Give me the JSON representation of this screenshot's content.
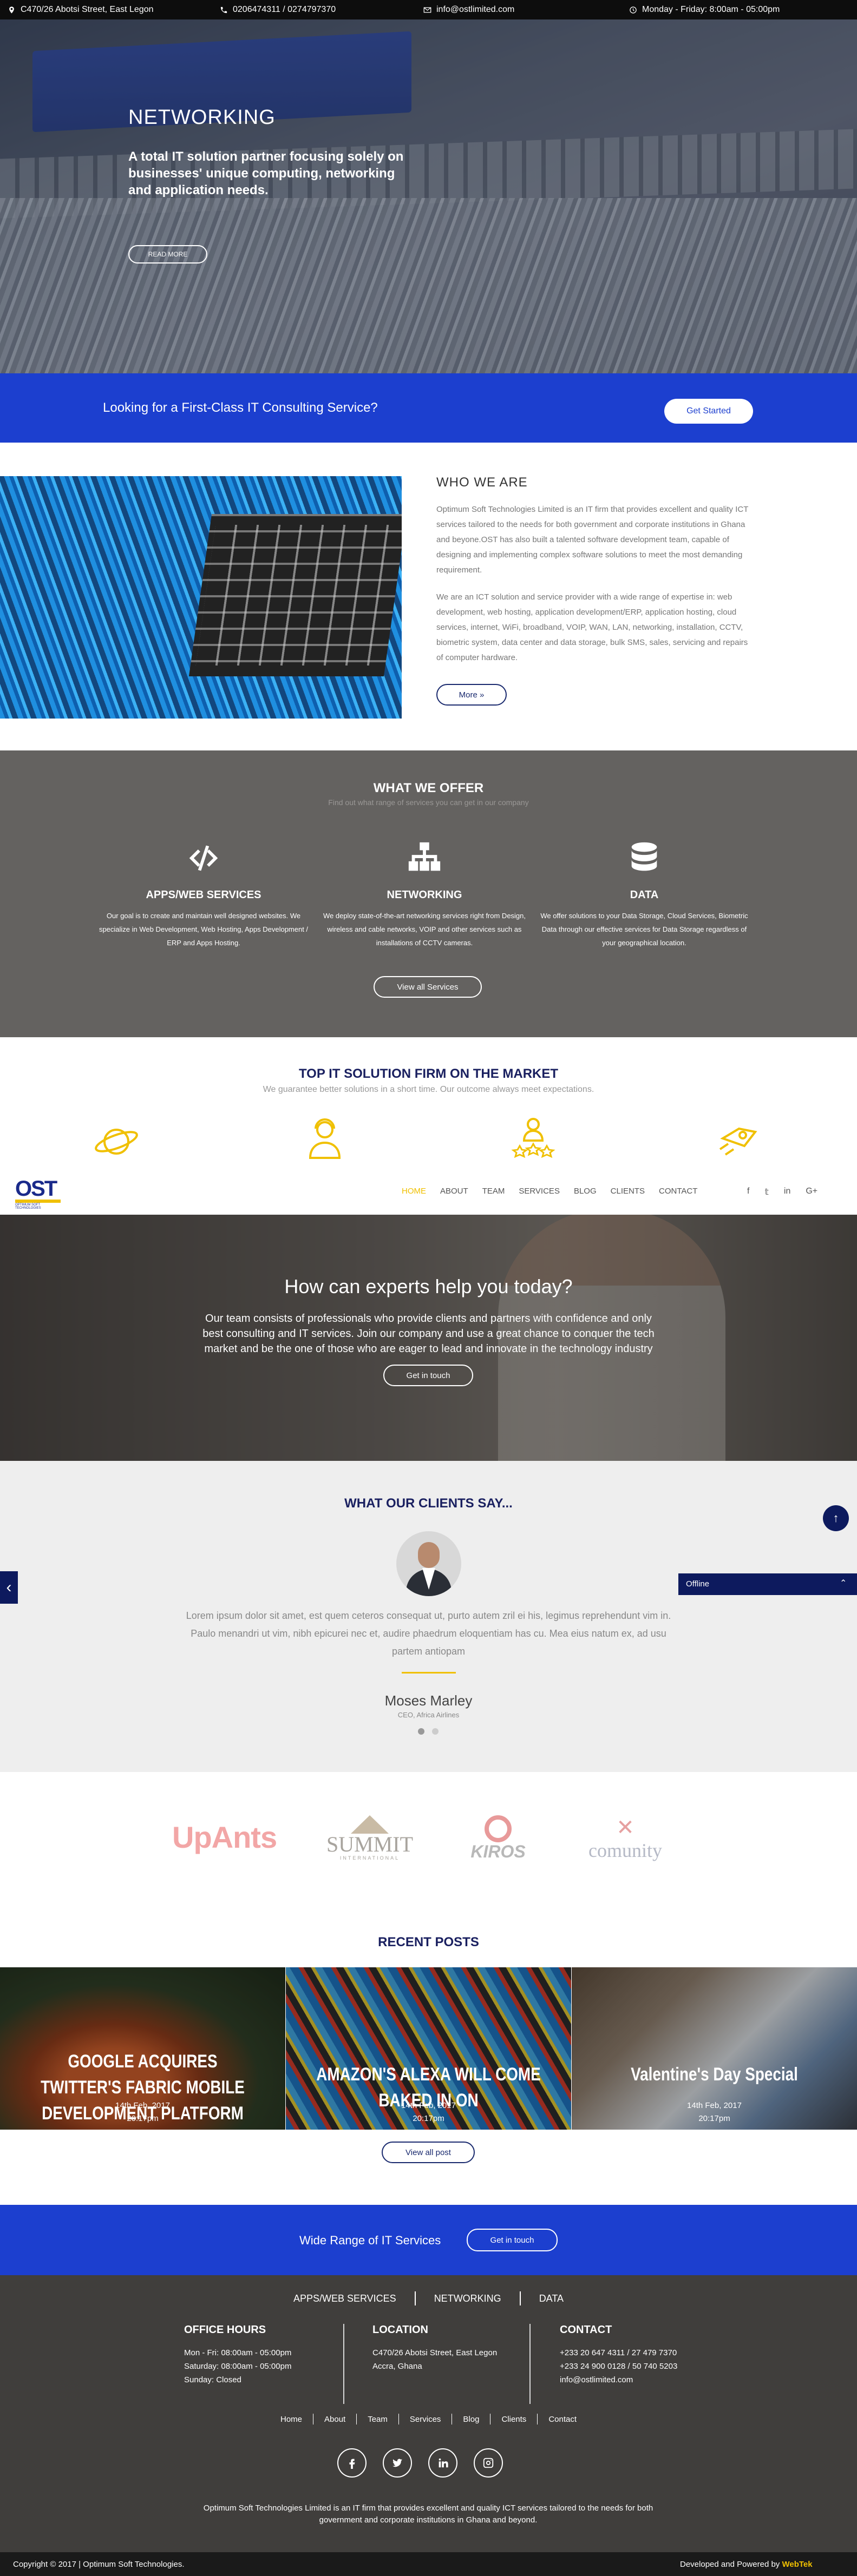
{
  "topbar": {
    "address": "C470/26 Abotsi Street, East Legon",
    "phone": "0206474311 / 0274797370",
    "email": "info@ostlimited.com",
    "hours": "Monday - Friday: 8:00am - 05:00pm"
  },
  "hero": {
    "title": "NETWORKING",
    "text": "A total IT solution partner focusing solely on businesses' unique computing, networking and application needs.",
    "button": "READ MORE"
  },
  "cta": {
    "text": "Looking for a First-Class IT Consulting Service?",
    "button": "Get Started"
  },
  "who": {
    "title": "WHO WE ARE",
    "p1": "Optimum Soft Technologies Limited is an IT firm that provides excellent and quality ICT services tailored to the needs for both government and corporate institutions in Ghana and beyone.OST has also built a talented software development team, capable of designing and implementing complex software solutions to meet the most demanding requirement.",
    "p2": "We are an ICT solution and service provider with a wide range of expertise in: web development, web hosting, application development/ERP, application hosting, cloud services, internet, WiFi, broadband, VOIP, WAN, LAN, networking, installation, CCTV, biometric system, data center and data storage, bulk SMS, sales, servicing and repairs of computer hardware.",
    "button": "More »"
  },
  "offer": {
    "title": "WHAT WE OFFER",
    "subtitle": "Find out what range of services you can get in our company",
    "services": [
      {
        "icon": "code-icon",
        "title": "APPS/WEB SERVICES",
        "text": "Our goal is to create and maintain well designed websites. We specialize in Web Development, Web Hosting, Apps Development / ERP and Apps Hosting."
      },
      {
        "icon": "sitemap-icon",
        "title": "NETWORKING",
        "text": "We deploy state-of-the-art networking services right from Design, wireless and cable networks, VOIP and other services such as installations of CCTV cameras."
      },
      {
        "icon": "database-icon",
        "title": "DATA",
        "text": "We offer solutions to your Data Storage, Cloud Services, Biometric Data through our effective services for Data Storage regardless of your geographical location."
      }
    ],
    "button": "View all Services"
  },
  "topit": {
    "title": "TOP IT SOLUTION FIRM ON THE MARKET",
    "subtitle": "We guarantee better solutions in a short time. Our outcome always meet expectations."
  },
  "nav": {
    "logo": "OST",
    "logo_sub": "OPTIMUM SOFT TECHNOLOGIES",
    "items": [
      "HOME",
      "ABOUT",
      "TEAM",
      "SERVICES",
      "BLOG",
      "CLIENTS",
      "CONTACT"
    ],
    "active_color": "#f0c000"
  },
  "experts": {
    "title": "How can experts help you today?",
    "text": "Our team consists of professionals who provide clients and partners with confidence and only best consulting and IT services. Join our company and use a great chance to conquer the tech market and be the one of those who are eager to lead and innovate in the technology industry",
    "button": "Get in touch"
  },
  "clients": {
    "title": "WHAT OUR CLIENTS SAY...",
    "quote": "Lorem ipsum dolor sit amet, est quem ceteros consequat ut, purto autem zril ei his, legimus reprehendunt vim in. Paulo menandri ut vim, nibh epicurei nec et, audire phaedrum eloquentiam has cu. Mea eius natum ex, ad usu partem antiopam",
    "name": "Moses Marley",
    "role": "CEO, Africa Airlines"
  },
  "chat": {
    "label": "Offline"
  },
  "partners": [
    "UpAnts",
    "SUMMIT",
    "KIROS",
    "comunity"
  ],
  "partners_sub": {
    "summit": "INTERNATIONAL"
  },
  "posts": {
    "title": "RECENT POSTS",
    "items": [
      {
        "title": "GOOGLE ACQUIRES TWITTER'S FABRIC MOBILE DEVELOPMENT PLATFORM",
        "date": "14th Feb, 2017",
        "time": "20:17pm"
      },
      {
        "title": "AMAZON'S ALEXA WILL COME BAKED IN ON",
        "date": "14th Feb, 2017",
        "time": "20:17pm"
      },
      {
        "title": "Valentine's Day Special",
        "date": "14th Feb, 2017",
        "time": "20:17pm"
      }
    ],
    "button": "View all post"
  },
  "cta2": {
    "text": "Wide Range of IT Services",
    "button": "Get in touch"
  },
  "footer": {
    "cats": [
      "APPS/WEB SERVICES",
      "NETWORKING",
      "DATA"
    ],
    "office": {
      "title": "OFFICE HOURS",
      "l1": "Mon - Fri: 08:00am - 05:00pm",
      "l2": "Saturday: 08:00am - 05:00pm",
      "l3": "Sunday: Closed"
    },
    "location": {
      "title": "LOCATION",
      "l1": "C470/26 Abotsi Street, East Legon",
      "l2": "Accra, Ghana"
    },
    "contact": {
      "title": "CONTACT",
      "l1": "+233 20 647 4311 / 27 479 7370",
      "l2": "+233 24 900 0128 / 50 740 5203",
      "l3": "info@ostlimited.com"
    },
    "links": [
      "Home",
      "About",
      "Team",
      "Services",
      "Blog",
      "Clients",
      "Contact"
    ],
    "about": "Optimum Soft Technologies Limited is an IT firm that provides excellent and quality ICT services tailored to the needs for both government and corporate institutions in Ghana and beyond.",
    "copyright": "Copyright © 2017 | Optimum Soft Technologies.",
    "powered": "Developed and Powered by",
    "powered_brand": "WebTek"
  },
  "colors": {
    "primary": "#1c3fcf",
    "navy": "#1a2060",
    "gold": "#f0c000",
    "dark": "#403e3c"
  }
}
